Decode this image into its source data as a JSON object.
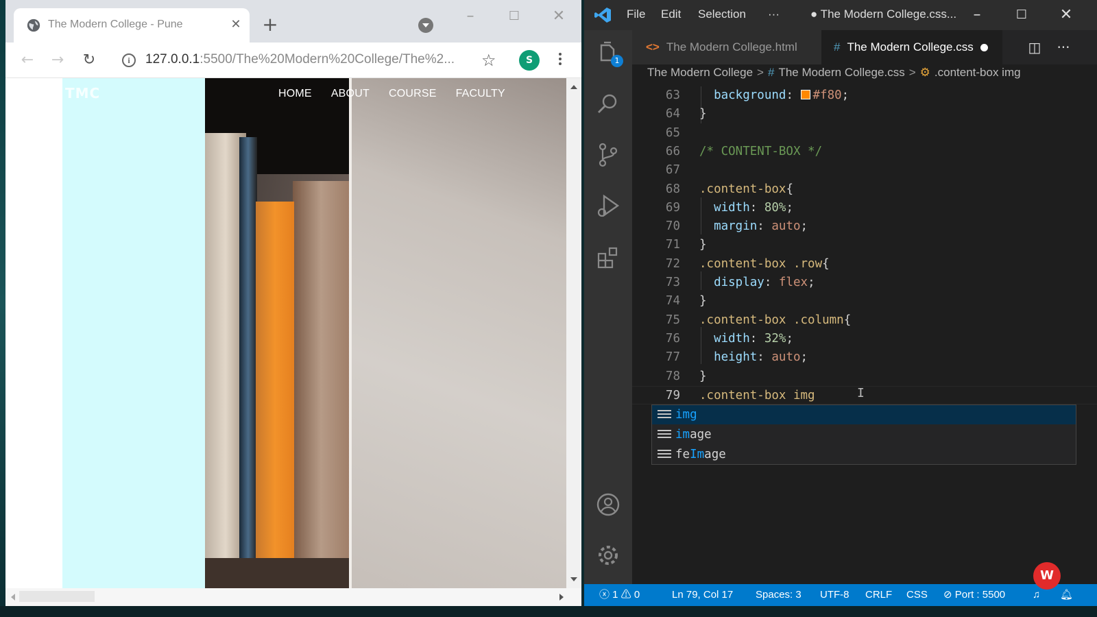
{
  "browser": {
    "tab_title": "The Modern College - Pune",
    "new_tab_label": "+",
    "url_host": "127.0.0.1",
    "url_rest": ":5500/The%20Modern%20College/The%2...",
    "avatar_letter": "S",
    "site": {
      "logo_text": "TMC",
      "nav": [
        "HOME",
        "ABOUT",
        "COURSE",
        "FACULTY"
      ]
    }
  },
  "vscode": {
    "menu": [
      "File",
      "Edit",
      "Selection",
      "···"
    ],
    "window_title": "● The Modern College.css...",
    "explorer_badge": "1",
    "tabs": [
      {
        "icon": "<>",
        "label": "The Modern College.html"
      },
      {
        "icon": "#",
        "label": "The Modern College.css"
      }
    ],
    "breadcrumb": {
      "folder": "The Modern College",
      "file_icon": "#",
      "file": "The Modern College.css",
      "symbol": ".content-box img"
    },
    "lines": [
      {
        "n": "63",
        "parts": [
          [
            "prop",
            "  background"
          ],
          [
            "punc",
            ": "
          ],
          [
            "swatch",
            ""
          ],
          [
            "val",
            "#f80"
          ],
          [
            "punc",
            ";"
          ]
        ]
      },
      {
        "n": "64",
        "parts": [
          [
            "punc",
            "}"
          ]
        ]
      },
      {
        "n": "65",
        "parts": []
      },
      {
        "n": "66",
        "parts": [
          [
            "cmt",
            "/* CONTENT-BOX */"
          ]
        ]
      },
      {
        "n": "67",
        "parts": []
      },
      {
        "n": "68",
        "parts": [
          [
            "sel",
            ".content-box"
          ],
          [
            "punc",
            "{"
          ]
        ]
      },
      {
        "n": "69",
        "parts": [
          [
            "prop",
            "  width"
          ],
          [
            "punc",
            ": "
          ],
          [
            "num",
            "80%"
          ],
          [
            "punc",
            ";"
          ]
        ]
      },
      {
        "n": "70",
        "parts": [
          [
            "prop",
            "  margin"
          ],
          [
            "punc",
            ": "
          ],
          [
            "val",
            "auto"
          ],
          [
            "punc",
            ";"
          ]
        ]
      },
      {
        "n": "71",
        "parts": [
          [
            "punc",
            "}"
          ]
        ]
      },
      {
        "n": "72",
        "parts": [
          [
            "sel",
            ".content-box .row"
          ],
          [
            "punc",
            "{"
          ]
        ]
      },
      {
        "n": "73",
        "parts": [
          [
            "prop",
            "  display"
          ],
          [
            "punc",
            ": "
          ],
          [
            "val",
            "flex"
          ],
          [
            "punc",
            ";"
          ]
        ]
      },
      {
        "n": "74",
        "parts": [
          [
            "punc",
            "}"
          ]
        ]
      },
      {
        "n": "75",
        "parts": [
          [
            "sel",
            ".content-box .column"
          ],
          [
            "punc",
            "{"
          ]
        ]
      },
      {
        "n": "76",
        "parts": [
          [
            "prop",
            "  width"
          ],
          [
            "punc",
            ": "
          ],
          [
            "num",
            "32%"
          ],
          [
            "punc",
            ";"
          ]
        ]
      },
      {
        "n": "77",
        "parts": [
          [
            "prop",
            "  height"
          ],
          [
            "punc",
            ": "
          ],
          [
            "val",
            "auto"
          ],
          [
            "punc",
            ";"
          ]
        ]
      },
      {
        "n": "78",
        "parts": [
          [
            "punc",
            "}"
          ]
        ]
      },
      {
        "n": "79",
        "parts": [
          [
            "sel",
            ".content-box img"
          ]
        ]
      }
    ],
    "suggestions": [
      {
        "pre": "",
        "hl": "img",
        "post": ""
      },
      {
        "pre": "",
        "hl": "im",
        "post": "age"
      },
      {
        "pre": "fe",
        "hl": "Im",
        "post": "age"
      }
    ],
    "status": {
      "errors": "1",
      "warnings": "0",
      "position": "Ln 79, Col 17",
      "spaces": "Spaces: 3",
      "encoding": "UTF-8",
      "eol": "CRLF",
      "language": "CSS",
      "port": "Port : 5500"
    }
  },
  "colors": {
    "swatch": "#ff8800",
    "statusbar": "#007acc",
    "logo_panel": "#d4fbfd"
  }
}
